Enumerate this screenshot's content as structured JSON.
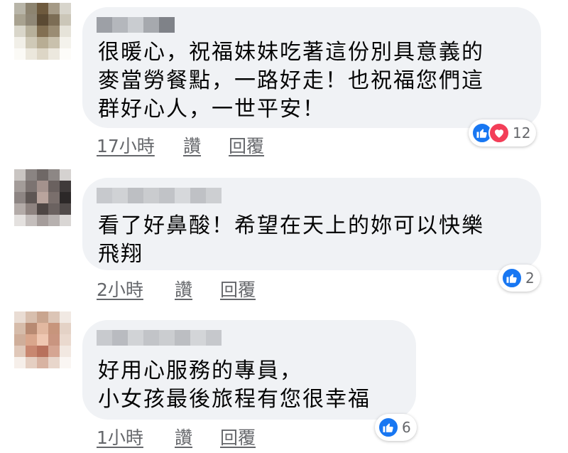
{
  "comments": [
    {
      "text": "很暖心，祝福妹妹吃著這份別具意義的\n麥當勞餐點，一路好走！也祝福您們這\n群好心人，一世平安！",
      "time": "17小時",
      "like_label": "讚",
      "reply_label": "回覆",
      "reaction_count": "12",
      "reactions": [
        "like-icon",
        "love-icon"
      ]
    },
    {
      "text": "看了好鼻酸！希望在天上的妳可以快樂\n飛翔",
      "time": "2小時",
      "like_label": "讚",
      "reply_label": "回覆",
      "reaction_count": "2",
      "reactions": [
        "like-icon"
      ]
    },
    {
      "text": "好用心服務的專員，\n小女孩最後旅程有您很幸福",
      "time": "1小時",
      "like_label": "讚",
      "reply_label": "回覆",
      "reaction_count": "6",
      "reactions": [
        "like-icon"
      ]
    }
  ],
  "colors": {
    "bubble": "#f0f2f5",
    "like": "#1877f2",
    "love": "#f33e58",
    "meta_text": "#65676b"
  }
}
